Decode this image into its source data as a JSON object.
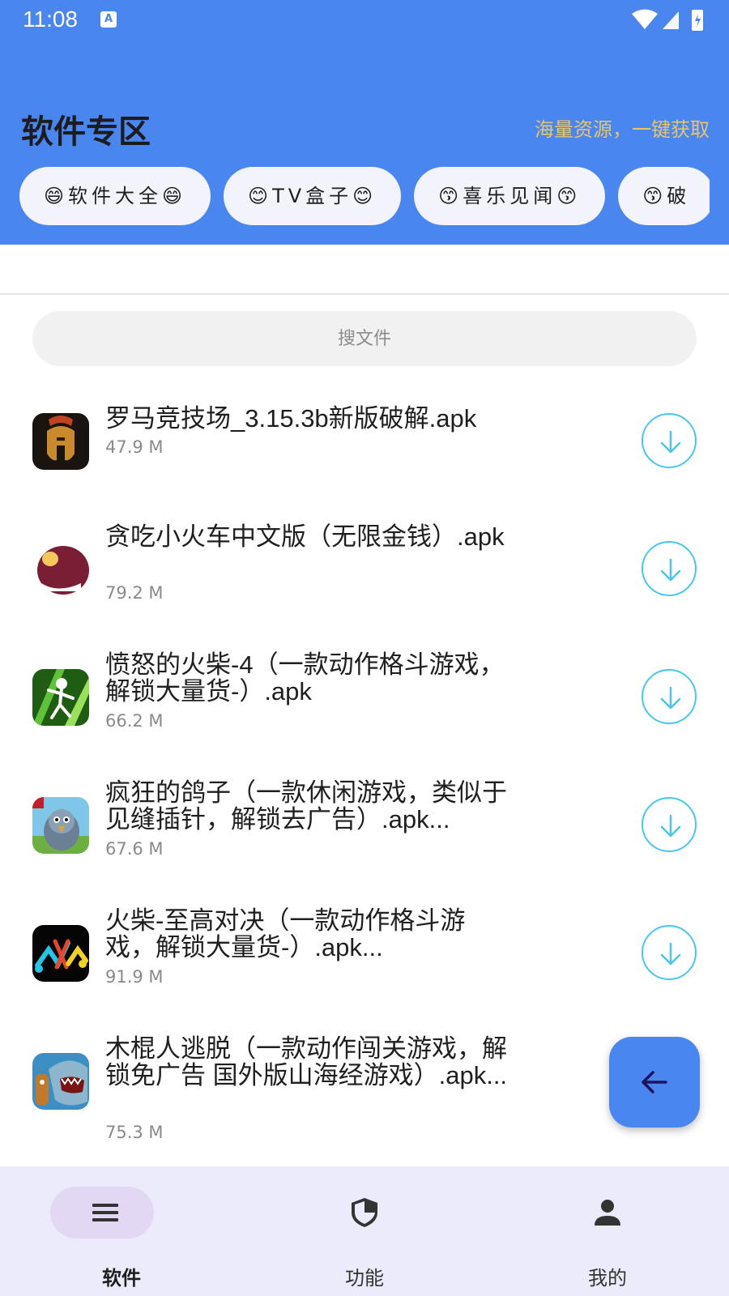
{
  "status_bar": {
    "time": "11:08",
    "notification_icon": "A"
  },
  "header": {
    "title": "软件专区",
    "slogan": "海量资源，一键获取",
    "chips": [
      {
        "label": "😄软件大全😄"
      },
      {
        "label": "😊TV盒子😊"
      },
      {
        "label": "😙喜乐见闻😙"
      },
      {
        "label": "😙破"
      }
    ]
  },
  "search": {
    "placeholder": "搜文件"
  },
  "files": [
    {
      "title": "罗马竞技场_3.15.3b新版破解.apk",
      "size": "47.9 M",
      "icon": "gladiator-helmet-icon"
    },
    {
      "title": "贪吃小火车中文版（无限金钱）.apk",
      "size": "79.2 M",
      "icon": "train-icon"
    },
    {
      "title": "愤怒的火柴-4（一款动作格斗游戏，解锁大量货-）.apk",
      "size": "66.2 M",
      "icon": "stickman-icon"
    },
    {
      "title": "疯狂的鸽子（一款休闲游戏，类似于见缝插针，解锁去广告）.apk...",
      "size": "67.6 M",
      "icon": "pigeon-icon"
    },
    {
      "title": "火柴-至高对决（一款动作格斗游戏，解锁大量货-）.apk...",
      "size": "91.9 M",
      "icon": "stick-duel-icon"
    },
    {
      "title": "木棍人逃脱（一款动作闯关游戏，解锁免广告 国外版山海经游戏）.apk...",
      "size": "75.3 M",
      "icon": "shark-icon"
    }
  ],
  "bottom_nav": [
    {
      "label": "软件",
      "icon": "menu-icon",
      "active": true
    },
    {
      "label": "功能",
      "icon": "shield-icon",
      "active": false
    },
    {
      "label": "我的",
      "icon": "person-icon",
      "active": false
    }
  ],
  "colors": {
    "primary": "#4a86f0",
    "accent_download": "#47c6ee",
    "slogan": "#e6c66a",
    "nav_bg": "#ebebfb"
  }
}
